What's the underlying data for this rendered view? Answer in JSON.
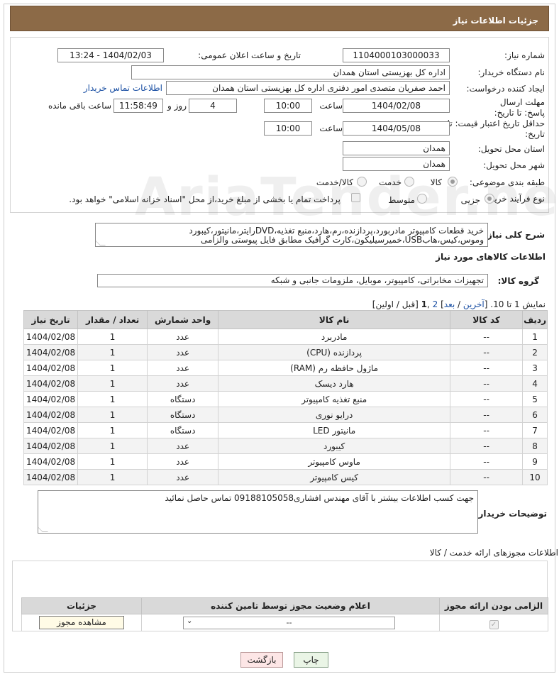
{
  "header": {
    "title": "جزئیات اطلاعات نیاز"
  },
  "form": {
    "need_number_label": "شماره نیاز:",
    "need_number": "1104000103000033",
    "announce_label": "تاریخ و ساعت اعلان عمومی:",
    "announce_value": "1404/02/03 - 13:24",
    "buyer_org_label": "نام دستگاه خریدار:",
    "buyer_org": "اداره کل بهزیستی استان همدان",
    "creator_label": "ایجاد کننده درخواست:",
    "creator": "احمد صفریان متصدی امور دفتری اداره کل بهزیستی استان همدان",
    "contact_link": "اطلاعات تماس خریدار",
    "deadline_label": "مهلت ارسال پاسخ: تا تاریخ:",
    "deadline_date": "1404/02/08",
    "time_label": "ساعت",
    "deadline_time": "10:00",
    "days_value": "4",
    "days_label": "روز و",
    "remaining_value": "11:58:49",
    "remaining_label": "ساعت باقی مانده",
    "validity_label": "حداقل تاریخ اعتبار قیمت: تا تاریخ:",
    "validity_date": "1404/05/08",
    "validity_time": "10:00",
    "province_label": "استان محل تحویل:",
    "province": "همدان",
    "city_label": "شهر محل تحویل:",
    "city": "همدان",
    "category_label": "طبقه بندی موضوعی:",
    "category_options": [
      "کالا",
      "خدمت",
      "کالا/خدمت"
    ],
    "category_selected": "کالا",
    "process_label": "نوع فرآیند خرید :",
    "process_options": [
      "جزیی",
      "متوسط"
    ],
    "process_selected": "جزیی",
    "payment_note": "پرداخت تمام یا بخشی از مبلغ خرید،از محل \"اسناد خزانه اسلامی\" خواهد بود."
  },
  "description": {
    "label": "شرح کلی نیاز:",
    "text": "خرید قطعات کامپیوتر مادربورد،پردازنده،رم،هارد،منبع تغذیه،DVDرایتر،مانیتور،کیبورد وموس،کیس،هابUSB،خمیرسیلیکون،کارت گرافیک مطابق فایل پیوستی والزامی"
  },
  "goods": {
    "section_title": "اطلاعات کالاهای مورد نیاز",
    "group_label": "گروه کالا:",
    "group_value": "تجهیزات مخابراتی، کامپیوتر، موبایل، ملزومات جانبی و شبکه",
    "pager_prefix": "نمایش 1 تا 10. [",
    "pager_last": "آخرین",
    "pager_sep1": " / ",
    "pager_next": "بعد",
    "pager_sep2": "] ",
    "pager_page2": "2",
    "pager_sep3": " ,",
    "pager_page1": "1",
    "pager_suffix": " [قبل / اولین]",
    "columns": [
      "ردیف",
      "کد کالا",
      "نام کالا",
      "واحد شمارش",
      "تعداد / مقدار",
      "تاریخ نیاز"
    ],
    "rows": [
      [
        "1",
        "--",
        "مادربرد",
        "عدد",
        "1",
        "1404/02/08"
      ],
      [
        "2",
        "--",
        "پردازنده (CPU)",
        "عدد",
        "1",
        "1404/02/08"
      ],
      [
        "3",
        "--",
        "ماژول حافظه رم (RAM)",
        "عدد",
        "1",
        "1404/02/08"
      ],
      [
        "4",
        "--",
        "هارد دیسک",
        "عدد",
        "1",
        "1404/02/08"
      ],
      [
        "5",
        "--",
        "منبع تغذیه کامپیوتر",
        "دستگاه",
        "1",
        "1404/02/08"
      ],
      [
        "6",
        "--",
        "درایو نوری",
        "دستگاه",
        "1",
        "1404/02/08"
      ],
      [
        "7",
        "--",
        "مانیتور LED",
        "دستگاه",
        "1",
        "1404/02/08"
      ],
      [
        "8",
        "--",
        "کیبورد",
        "عدد",
        "1",
        "1404/02/08"
      ],
      [
        "9",
        "--",
        "ماوس کامپیوتر",
        "عدد",
        "1",
        "1404/02/08"
      ],
      [
        "10",
        "--",
        "کیس کامپیوتر",
        "عدد",
        "1",
        "1404/02/08"
      ]
    ]
  },
  "buyer_notes": {
    "label": "توضیحات خریدار:",
    "text": "جهت کسب اطلاعات بیشتر با آقای مهندس افشاری09188105058 تماس حاصل نمائید"
  },
  "licenses": {
    "section_title": "اطلاعات مجوزهای ارائه خدمت / کالا",
    "columns": [
      "الزامی بودن ارائه مجوز",
      "اعلام وضعیت مجوز توسط تامین کننده",
      "جزئیات"
    ],
    "select_value": "--",
    "view_button": "مشاهده مجوز"
  },
  "footer": {
    "print_button": "چاپ",
    "back_button": "بازگشت"
  },
  "watermark": "AriaTender.neT"
}
